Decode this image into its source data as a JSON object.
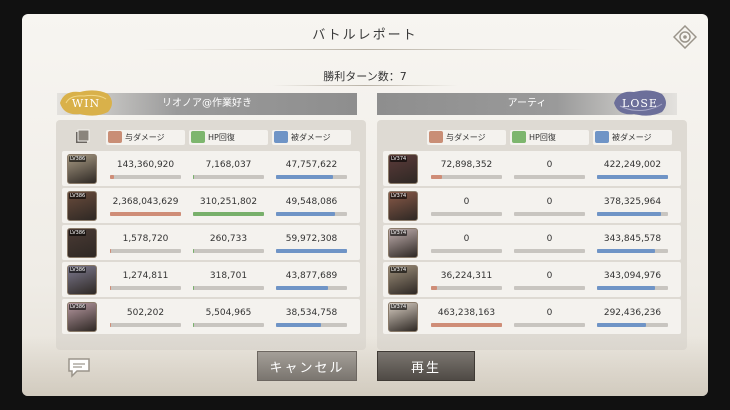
{
  "title": "バトルレポート",
  "turn_count": "勝利ターン数：7",
  "cancel_label": "キャンセル",
  "play_label": "再生",
  "colors": {
    "damage_fill": "#cf8d77",
    "heal_fill": "#78b06b",
    "taken_fill": "#6f94c6",
    "win_badge": "#d9b14a",
    "lose_badge": "#6c6f9a"
  },
  "left": {
    "badge": "WIN",
    "team_name": "リオノア@作業好き",
    "headers": {
      "damage": "与ダメージ",
      "heal": "HP回復",
      "taken": "被ダメージ"
    },
    "members": [
      {
        "level": "LV386",
        "damage": "143,360,920",
        "heal": "7,168,037",
        "taken": "47,757,622",
        "damage_pct": 0.06,
        "heal_pct": 0.02,
        "taken_pct": 0.8,
        "portrait": "#a89b84"
      },
      {
        "level": "LV386",
        "damage": "2,368,043,629",
        "heal": "310,251,802",
        "taken": "49,548,086",
        "damage_pct": 1.0,
        "heal_pct": 1.0,
        "taken_pct": 0.83,
        "portrait": "#6a4c3c"
      },
      {
        "level": "LV386",
        "damage": "1,578,720",
        "heal": "260,733",
        "taken": "59,972,308",
        "damage_pct": 0.01,
        "heal_pct": 0.01,
        "taken_pct": 1.0,
        "portrait": "#4a3a34"
      },
      {
        "level": "LV386",
        "damage": "1,274,811",
        "heal": "318,701",
        "taken": "43,877,689",
        "damage_pct": 0.01,
        "heal_pct": 0.01,
        "taken_pct": 0.73,
        "portrait": "#7d7a8f"
      },
      {
        "level": "LV386",
        "damage": "502,202",
        "heal": "5,504,965",
        "taken": "38,534,758",
        "damage_pct": 0.01,
        "heal_pct": 0.02,
        "taken_pct": 0.64,
        "portrait": "#b89aa2"
      }
    ]
  },
  "right": {
    "badge": "LOSE",
    "team_name": "アーティ",
    "headers": {
      "damage": "与ダメージ",
      "heal": "HP回復",
      "taken": "被ダメージ"
    },
    "members": [
      {
        "level": "LV374",
        "damage": "72,898,352",
        "heal": "0",
        "taken": "422,249,002",
        "damage_pct": 0.16,
        "heal_pct": 0,
        "taken_pct": 1.0,
        "portrait": "#5c3b3a"
      },
      {
        "level": "LV374",
        "damage": "0",
        "heal": "0",
        "taken": "378,325,964",
        "damage_pct": 0,
        "heal_pct": 0,
        "taken_pct": 0.9,
        "portrait": "#8a5a48"
      },
      {
        "level": "LV374",
        "damage": "0",
        "heal": "0",
        "taken": "343,845,578",
        "damage_pct": 0,
        "heal_pct": 0,
        "taken_pct": 0.81,
        "portrait": "#c2b1b0"
      },
      {
        "level": "LV374",
        "damage": "36,224,311",
        "heal": "0",
        "taken": "343,094,976",
        "damage_pct": 0.08,
        "heal_pct": 0,
        "taken_pct": 0.81,
        "portrait": "#9d8f7a"
      },
      {
        "level": "LV374",
        "damage": "463,238,163",
        "heal": "0",
        "taken": "292,436,236",
        "damage_pct": 1.0,
        "heal_pct": 0,
        "taken_pct": 0.69,
        "portrait": "#d9cfc3"
      }
    ]
  }
}
